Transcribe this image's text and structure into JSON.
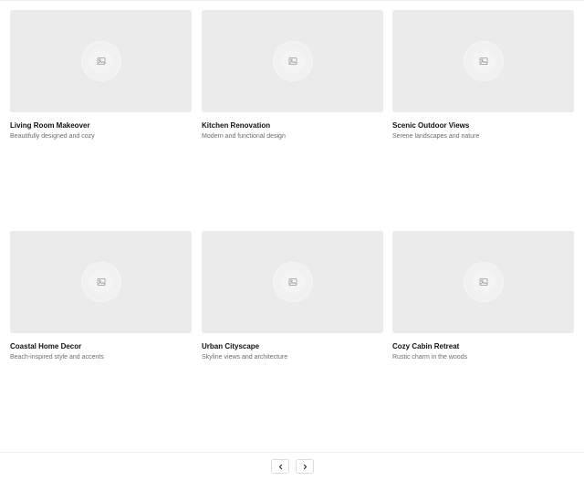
{
  "gallery": {
    "cards": [
      {
        "title": "Living Room Makeover",
        "description": "Beautifully designed and cozy",
        "icon": "image-placeholder-icon"
      },
      {
        "title": "Kitchen Renovation",
        "description": "Modern and functional design",
        "icon": "image-placeholder-icon"
      },
      {
        "title": "Scenic Outdoor Views",
        "description": "Serene landscapes and nature",
        "icon": "image-placeholder-icon"
      },
      {
        "title": "Coastal Home Decor",
        "description": "Beach-inspired style and accents",
        "icon": "image-placeholder-icon"
      },
      {
        "title": "Urban Cityscape",
        "description": "Skyline views and architecture",
        "icon": "image-placeholder-icon"
      },
      {
        "title": "Cozy Cabin Retreat",
        "description": "Rustic charm in the woods",
        "icon": "image-placeholder-icon"
      }
    ]
  },
  "pagination": {
    "prev_icon": "chevron-left-icon",
    "next_icon": "chevron-right-icon"
  },
  "colors": {
    "thumbnail_bg": "#ebebeb",
    "title_text": "#111111",
    "description_text": "#6d6d6d",
    "border": "#dddddd"
  }
}
